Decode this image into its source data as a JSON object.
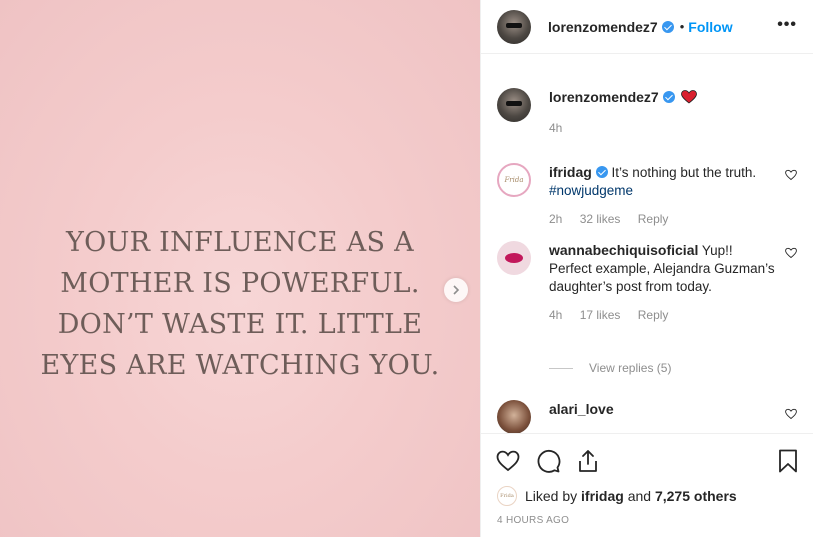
{
  "post": {
    "quote_lines": [
      "YOUR INFLUENCE AS A",
      "MOTHER IS POWERFUL.",
      "DON’T WASTE IT. LITTLE",
      "EYES ARE WATCHING YOU."
    ]
  },
  "header": {
    "username": "lorenzomendez7",
    "separator": "•",
    "follow_label": "Follow",
    "more_label": "•••"
  },
  "caption": {
    "username": "lorenzomendez7",
    "time": "4h"
  },
  "comments": [
    {
      "username": "ifridag",
      "text": "It’s nothing but the truth.",
      "hashtag": "#nowjudgeme",
      "time": "2h",
      "likes": "32 likes",
      "reply_label": "Reply",
      "avatar_text": "Frida"
    },
    {
      "username": "wannabechiquisoficial",
      "text": "Yup!! Perfect example, Alejandra Guzman’s daughter’s post from today.",
      "time": "4h",
      "likes": "17 likes",
      "reply_label": "Reply"
    },
    {
      "username": "alari_love"
    }
  ],
  "view_replies": "View replies (5)",
  "likes_line": {
    "prefix": "Liked by",
    "user": "ifridag",
    "middle": "and",
    "count": "7,275 others"
  },
  "timestamp": "4 HOURS AGO",
  "colors": {
    "accent": "#0095f6",
    "verified": "#3897f0",
    "heart_red": "#ed4956"
  }
}
